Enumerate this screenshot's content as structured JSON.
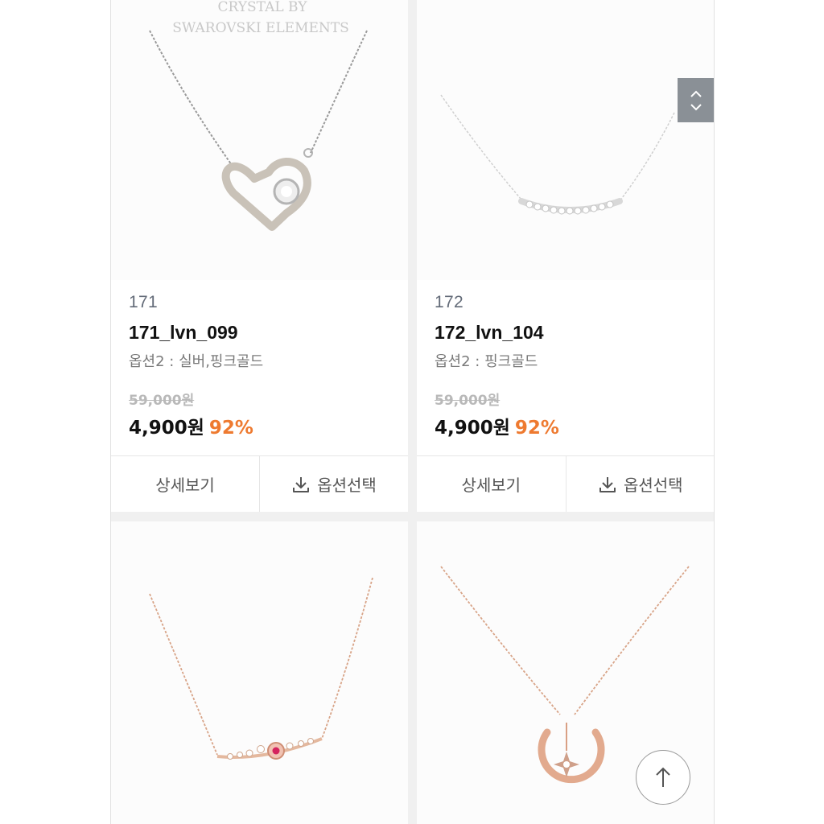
{
  "products": [
    {
      "number": "171",
      "name": "171_lvn_099",
      "option": "옵션2 : 실버,핑크골드",
      "original_price": "59,000원",
      "price": "4,900원",
      "discount": "92%",
      "watermark_line1": "CRYSTAL BY",
      "watermark_line2": "SWAROVSKI ELEMENTS",
      "detail_label": "상세보기",
      "option_select_label": "옵션선택"
    },
    {
      "number": "172",
      "name": "172_lvn_104",
      "option": "옵션2 : 핑크골드",
      "original_price": "59,000원",
      "price": "4,900원",
      "discount": "92%",
      "detail_label": "상세보기",
      "option_select_label": "옵션선택"
    }
  ],
  "colors": {
    "discount": "#ee7a30",
    "muted_text": "#7a7a7a",
    "strikethrough": "#b9b9b9",
    "scroll_handle": "#8a9096"
  },
  "icons": {
    "download": "download-icon",
    "scroll_up": "chevron-up-icon",
    "scroll_down": "chevron-down-icon",
    "back_to_top": "arrow-up-icon"
  }
}
